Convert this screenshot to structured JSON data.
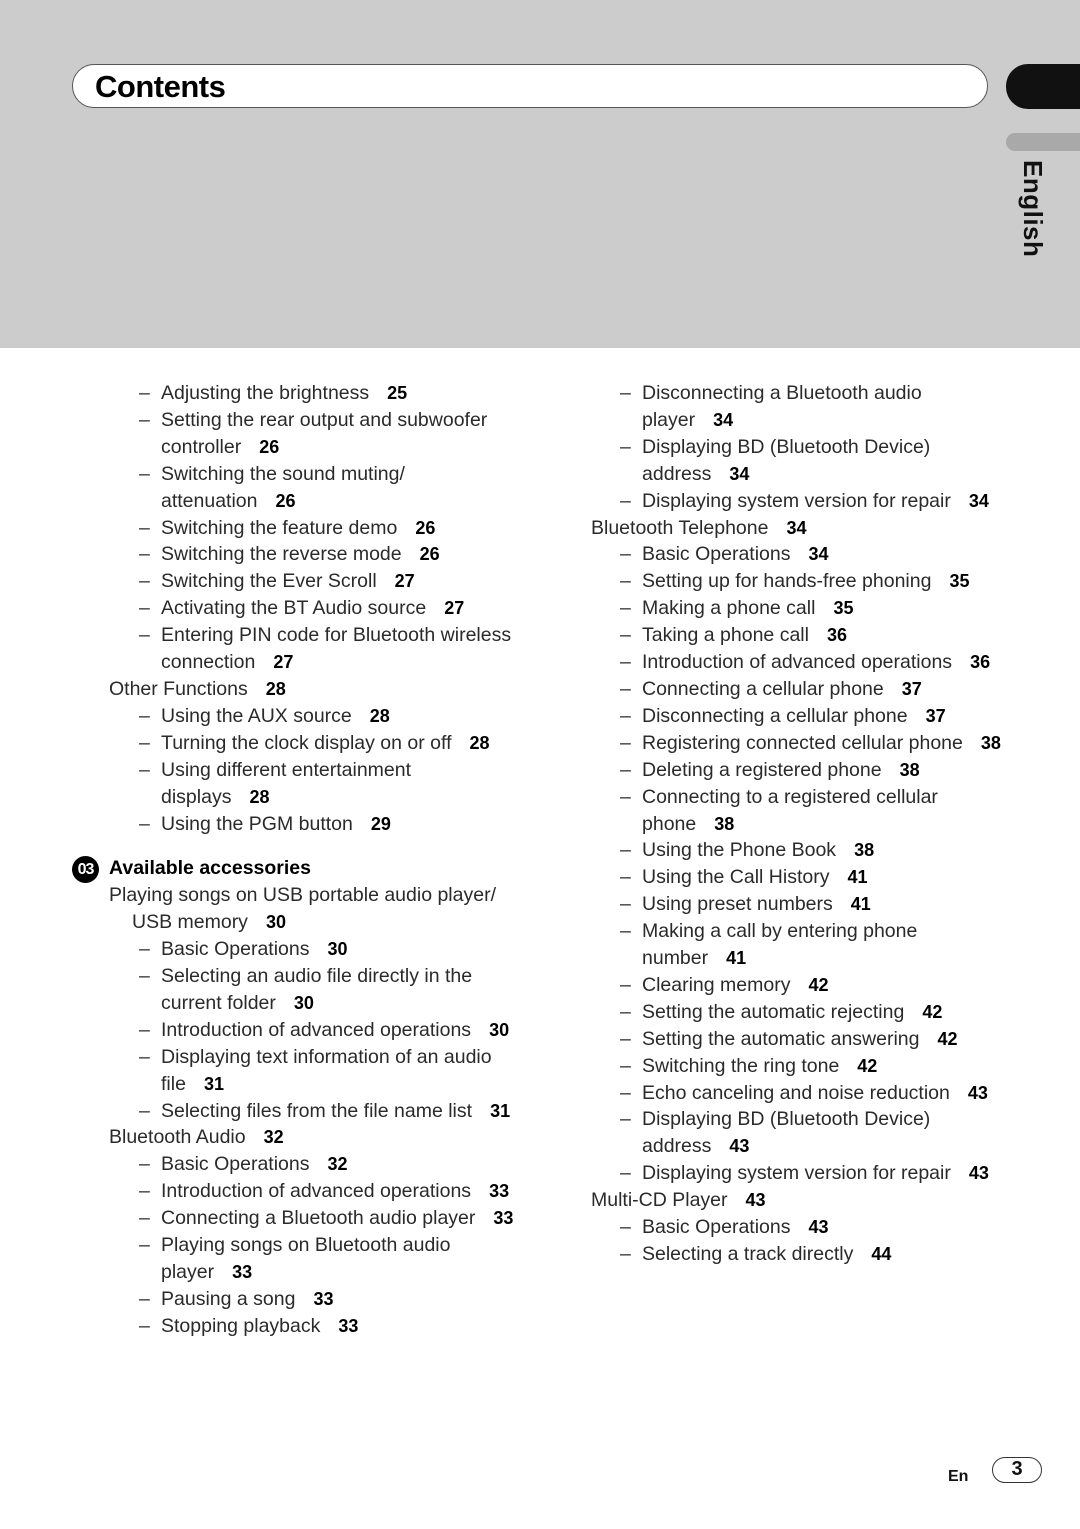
{
  "header": {
    "title": "Contents",
    "language_tab": "English"
  },
  "left_column": [
    {
      "level": 2,
      "text": "Adjusting the brightness",
      "page": "25"
    },
    {
      "level": 2,
      "text": "Setting the rear output and subwoofer controller",
      "page": "26"
    },
    {
      "level": 2,
      "text": "Switching the sound muting/ attenuation",
      "page": "26"
    },
    {
      "level": 2,
      "text": "Switching the feature demo",
      "page": "26"
    },
    {
      "level": 2,
      "text": "Switching the reverse mode",
      "page": "26"
    },
    {
      "level": 2,
      "text": "Switching the Ever Scroll",
      "page": "27"
    },
    {
      "level": 2,
      "text": "Activating the BT Audio source",
      "page": "27"
    },
    {
      "level": 2,
      "text": "Entering PIN code for Bluetooth wireless connection",
      "page": "27"
    },
    {
      "level": 1,
      "text": "Other Functions",
      "page": "28"
    },
    {
      "level": 2,
      "text": "Using the AUX source",
      "page": "28"
    },
    {
      "level": 2,
      "text": "Turning the clock display on or off",
      "page": "28"
    },
    {
      "level": 2,
      "text": "Using different entertainment displays",
      "page": "28"
    },
    {
      "level": 2,
      "text": "Using the PGM button",
      "page": "29"
    },
    {
      "level": 0,
      "badge": "03",
      "text": "Available accessories"
    },
    {
      "level": 1,
      "wrap2": true,
      "text": "Playing songs on USB portable audio player/ USB memory",
      "page": "30"
    },
    {
      "level": 2,
      "text": "Basic Operations",
      "page": "30"
    },
    {
      "level": 2,
      "text": "Selecting an audio file directly in the current folder",
      "page": "30"
    },
    {
      "level": 2,
      "text": "Introduction of advanced operations",
      "page": "30"
    },
    {
      "level": 2,
      "text": "Displaying text information of an audio file",
      "page": "31"
    },
    {
      "level": 2,
      "text": "Selecting files from the file name list",
      "page": "31"
    },
    {
      "level": 1,
      "text": "Bluetooth Audio",
      "page": "32"
    },
    {
      "level": 2,
      "text": "Basic Operations",
      "page": "32"
    },
    {
      "level": 2,
      "text": "Introduction of advanced operations",
      "page": "33"
    },
    {
      "level": 2,
      "text": "Connecting a Bluetooth audio player",
      "page": "33"
    },
    {
      "level": 2,
      "text": "Playing songs on Bluetooth audio player",
      "page": "33"
    },
    {
      "level": 2,
      "text": "Pausing a song",
      "page": "33"
    },
    {
      "level": 2,
      "text": "Stopping playback",
      "page": "33"
    }
  ],
  "right_column": [
    {
      "level": 2,
      "text": "Disconnecting a Bluetooth audio player",
      "page": "34"
    },
    {
      "level": 2,
      "text": "Displaying BD (Bluetooth Device) address",
      "page": "34"
    },
    {
      "level": 2,
      "text": "Displaying system version for repair",
      "page": "34"
    },
    {
      "level": 1,
      "text": "Bluetooth Telephone",
      "page": "34"
    },
    {
      "level": 2,
      "text": "Basic Operations",
      "page": "34"
    },
    {
      "level": 2,
      "text": "Setting up for hands-free phoning",
      "page": "35"
    },
    {
      "level": 2,
      "text": "Making a phone call",
      "page": "35"
    },
    {
      "level": 2,
      "text": "Taking a phone call",
      "page": "36"
    },
    {
      "level": 2,
      "text": "Introduction of advanced operations",
      "page": "36"
    },
    {
      "level": 2,
      "text": "Connecting a cellular phone",
      "page": "37"
    },
    {
      "level": 2,
      "text": "Disconnecting a cellular phone",
      "page": "37"
    },
    {
      "level": 2,
      "text": "Registering connected cellular phone",
      "page": "38"
    },
    {
      "level": 2,
      "text": "Deleting a registered phone",
      "page": "38"
    },
    {
      "level": 2,
      "text": "Connecting to a registered cellular phone",
      "page": "38"
    },
    {
      "level": 2,
      "text": "Using the Phone Book",
      "page": "38"
    },
    {
      "level": 2,
      "text": "Using the Call History",
      "page": "41"
    },
    {
      "level": 2,
      "text": "Using preset numbers",
      "page": "41"
    },
    {
      "level": 2,
      "text": "Making a call by entering phone number",
      "page": "41"
    },
    {
      "level": 2,
      "text": "Clearing memory",
      "page": "42"
    },
    {
      "level": 2,
      "text": "Setting the automatic rejecting",
      "page": "42"
    },
    {
      "level": 2,
      "text": "Setting the automatic answering",
      "page": "42"
    },
    {
      "level": 2,
      "text": "Switching the ring tone",
      "page": "42"
    },
    {
      "level": 2,
      "text": "Echo canceling and noise reduction",
      "page": "43"
    },
    {
      "level": 2,
      "text": "Displaying BD (Bluetooth Device) address",
      "page": "43"
    },
    {
      "level": 2,
      "text": "Displaying system version for repair",
      "page": "43"
    },
    {
      "level": 1,
      "text": "Multi-CD Player",
      "page": "43"
    },
    {
      "level": 2,
      "text": "Basic Operations",
      "page": "43"
    },
    {
      "level": 2,
      "text": "Selecting a track directly",
      "page": "44"
    }
  ],
  "symbols": {
    "dash": "–"
  },
  "footer": {
    "lang_code": "En",
    "page_number": "3"
  }
}
